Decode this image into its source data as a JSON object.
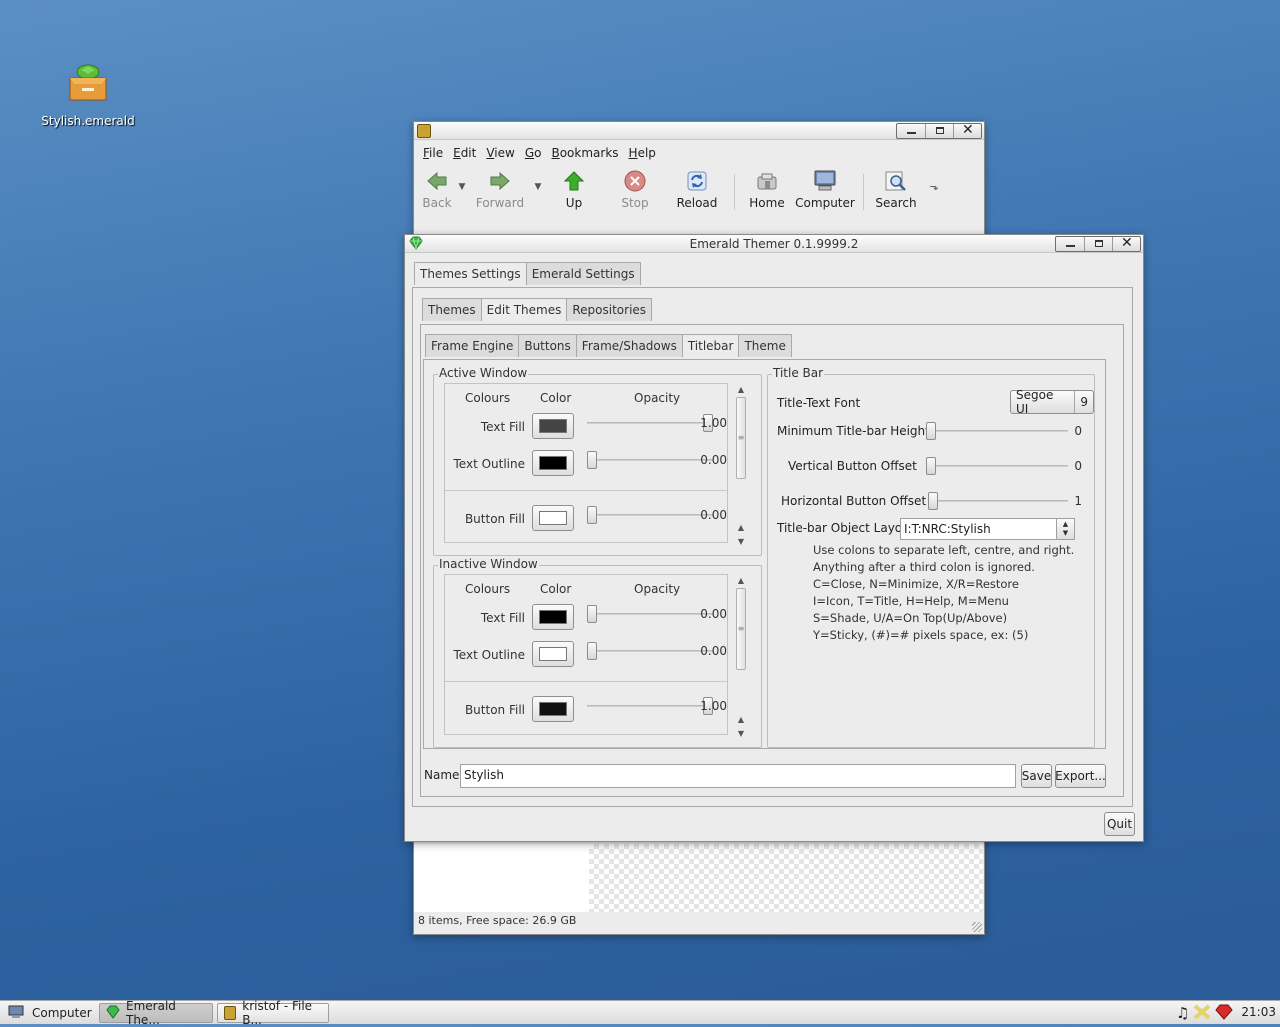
{
  "desktop": {
    "icon_label": "Stylish.emerald"
  },
  "file_browser": {
    "menu": [
      "File",
      "Edit",
      "View",
      "Go",
      "Bookmarks",
      "Help"
    ],
    "toolbar": {
      "back": "Back",
      "forward": "Forward",
      "up": "Up",
      "stop": "Stop",
      "reload": "Reload",
      "home": "Home",
      "computer": "Computer",
      "search": "Search"
    },
    "status": "8 items, Free space: 26.9 GB"
  },
  "emerald": {
    "title": "Emerald Themer 0.1.9999.2",
    "top_tabs": [
      "Themes Settings",
      "Emerald Settings"
    ],
    "sub_tabs": [
      "Themes",
      "Edit Themes",
      "Repositories"
    ],
    "edit_tabs": [
      "Frame Engine",
      "Buttons",
      "Frame/Shadows",
      "Titlebar",
      "Theme"
    ],
    "active_window": {
      "label": "Active Window",
      "headers": {
        "colours": "Colours",
        "color": "Color",
        "opacity": "Opacity"
      },
      "rows": [
        {
          "label": "Text Fill",
          "swatch": "#444444",
          "opacity": 1.0,
          "value": "1.00"
        },
        {
          "label": "Text Outline",
          "swatch": "#000000",
          "opacity": 0.0,
          "value": "0.00"
        },
        {
          "label": "Button Fill",
          "swatch": "#ffffff",
          "opacity": 0.0,
          "value": "0.00"
        }
      ]
    },
    "inactive_window": {
      "label": "Inactive Window",
      "headers": {
        "colours": "Colours",
        "color": "Color",
        "opacity": "Opacity"
      },
      "rows": [
        {
          "label": "Text Fill",
          "swatch": "#000000",
          "opacity": 0.0,
          "value": "0.00"
        },
        {
          "label": "Text Outline",
          "swatch": "#ffffff",
          "opacity": 0.0,
          "value": "0.00"
        },
        {
          "label": "Button Fill",
          "swatch": "#111111",
          "opacity": 1.0,
          "value": "1.00"
        }
      ]
    },
    "title_bar": {
      "label": "Title Bar",
      "font_label": "Title-Text Font",
      "font_name": "Segoe UI",
      "font_size": "9",
      "min_height_label": "Minimum Title-bar Height",
      "min_height_value": "0",
      "vert_offset_label": "Vertical Button Offset",
      "vert_offset_value": "0",
      "horiz_offset_label": "Horizontal Button Offset",
      "horiz_offset_value": "1",
      "layout_label": "Title-bar Object Layout",
      "layout_value": "I:T:NRC:Stylish",
      "help": [
        "Use colons to separate left, centre, and right.",
        "Anything after a third colon is ignored.",
        "C=Close, N=Minimize, X/R=Restore",
        "I=Icon, T=Title, H=Help, M=Menu",
        "S=Shade, U/A=On Top(Up/Above)",
        "Y=Sticky, (#)=# pixels space, ex: (5)"
      ]
    },
    "name_label": "Name:",
    "name_value": "Stylish",
    "save": "Save",
    "export": "Export...",
    "quit": "Quit"
  },
  "taskbar": {
    "start": "Computer",
    "tasks": [
      "Emerald The...",
      "kristof - File B..."
    ],
    "clock": "21:03"
  }
}
